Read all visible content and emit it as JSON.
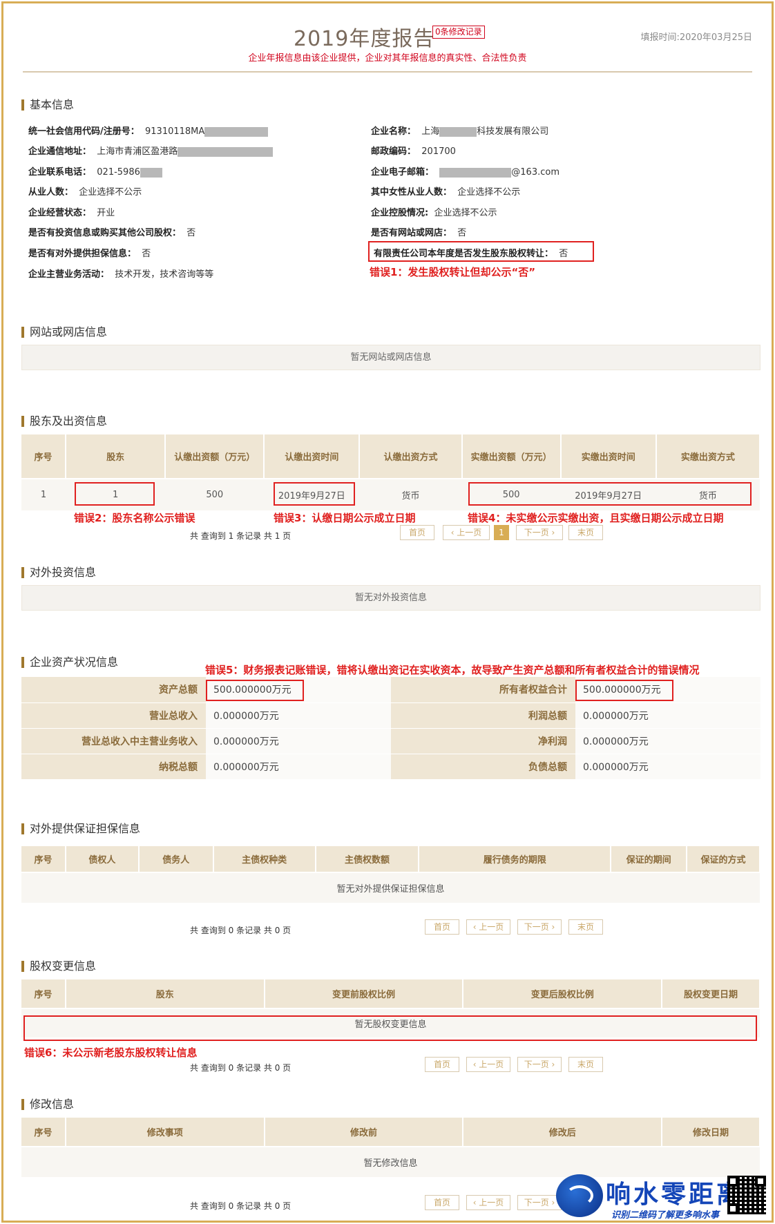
{
  "header": {
    "title": "2019年度报告",
    "revision_badge": "0条修改记录",
    "fill_time": "填报时间:2020年03月25日",
    "subtitle": "企业年报信息由该企业提供，企业对其年报信息的真实性、合法性负责"
  },
  "basic": {
    "section_title": "基本信息",
    "credit_code_label": "统一社会信用代码/注册号：",
    "credit_code_value": "91310118MA",
    "company_name_label": "企业名称：",
    "company_name_prefix": "上海",
    "company_name_suffix": "科技发展有限公司",
    "address_label": "企业通信地址：",
    "address_value": "上海市青浦区盈港路",
    "postcode_label": "邮政编码：",
    "postcode_value": "201700",
    "phone_label": "企业联系电话：",
    "phone_value": "021-5986",
    "email_label": "企业电子邮箱：",
    "email_suffix": "@163.com",
    "employees_label": "从业人数：",
    "employees_value": "企业选择不公示",
    "female_label": "其中女性从业人数：",
    "female_value": "企业选择不公示",
    "status_label": "企业经营状态：",
    "status_value": "开业",
    "holding_label": "企业控股情况:",
    "holding_value": "企业选择不公示",
    "invest_label": "是否有投资信息或购买其他公司股权：",
    "invest_value": "否",
    "website_label": "是否有网站或网店：",
    "website_value": "否",
    "guarantee_label": "是否有对外提供担保信息：",
    "guarantee_value": "否",
    "equity_transfer_label": "有限责任公司本年度是否发生股东股权转让：",
    "equity_transfer_value": "否",
    "business_label": "企业主营业务活动：",
    "business_value": "技术开发，技术咨询等等"
  },
  "errors": {
    "e1": "错误1：发生股权转让但却公示“否”",
    "e2": "错误2：股东名称公示错误",
    "e3": "错误3：认缴日期公示成立日期",
    "e4": "错误4：未实缴公示实缴出资，且实缴日期公示成立日期",
    "e5": "错误5：财务报表记账错误，错将认缴出资记在实收资本，故导致产生资产总额和所有者权益合计的错误情况",
    "e6": "错误6：未公示新老股东股权转让信息"
  },
  "website": {
    "section_title": "网站或网店信息",
    "empty": "暂无网站或网店信息"
  },
  "shareholders": {
    "section_title": "股东及出资信息",
    "headers": [
      "序号",
      "股东",
      "认缴出资额（万元）",
      "认缴出资时间",
      "认缴出资方式",
      "实缴出资额（万元）",
      "实缴出资时间",
      "实缴出资方式"
    ],
    "row": [
      "1",
      "1",
      "500",
      "2019年9月27日",
      "货币",
      "500",
      "2019年9月27日",
      "货币"
    ],
    "pager_info": "共 查询到 1 条记录 共 1 页",
    "current_page": "1"
  },
  "pager": {
    "first": "首页",
    "prev": "‹ 上一页",
    "next": "下一页 ›",
    "last": "末页"
  },
  "investment": {
    "section_title": "对外投资信息",
    "empty": "暂无对外投资信息"
  },
  "assets": {
    "section_title": "企业资产状况信息",
    "rows": [
      {
        "k1": "资产总额",
        "v1": "500.000000万元",
        "k2": "所有者权益合计",
        "v2": "500.000000万元"
      },
      {
        "k1": "营业总收入",
        "v1": "0.000000万元",
        "k2": "利润总额",
        "v2": "0.000000万元"
      },
      {
        "k1": "营业总收入中主营业务收入",
        "v1": "0.000000万元",
        "k2": "净利润",
        "v2": "0.000000万元"
      },
      {
        "k1": "纳税总额",
        "v1": "0.000000万元",
        "k2": "负债总额",
        "v2": "0.000000万元"
      }
    ]
  },
  "guarantees": {
    "section_title": "对外提供保证担保信息",
    "headers": [
      "序号",
      "债权人",
      "债务人",
      "主债权种类",
      "主债权数额",
      "履行债务的期限",
      "保证的期间",
      "保证的方式"
    ],
    "empty": "暂无对外提供保证担保信息",
    "pager_info": "共 查询到 0 条记录 共 0 页"
  },
  "equity_changes": {
    "section_title": "股权变更信息",
    "headers": [
      "序号",
      "股东",
      "变更前股权比例",
      "变更后股权比例",
      "股权变更日期"
    ],
    "empty": "暂无股权变更信息",
    "pager_info": "共 查询到 0 条记录 共 0 页"
  },
  "modifications": {
    "section_title": "修改信息",
    "headers": [
      "序号",
      "修改事项",
      "修改前",
      "修改后",
      "修改日期"
    ],
    "empty": "暂无修改信息",
    "pager_info": "共 查询到 0 条记录 共 0 页"
  },
  "watermark": {
    "brand": "响水零距离",
    "slogan": "识别二维码了解更多响水事"
  }
}
